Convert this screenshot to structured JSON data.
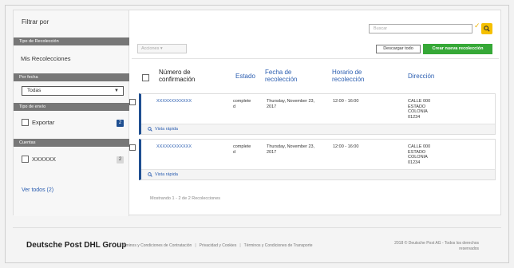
{
  "sidebar": {
    "title": "Filtrar por",
    "sections": [
      {
        "header": "Tipo de Recolección",
        "item": "Mis Recolecciones"
      },
      {
        "header": "Por fecha",
        "select_value": "Todas"
      },
      {
        "header": "Tipo de envío",
        "checkbox_label": "Exportar",
        "count": "2"
      },
      {
        "header": "Cuentas",
        "checkbox_label": "XXXXXX",
        "count": "2"
      }
    ],
    "view_all": "Ver todos (2)"
  },
  "toolbar": {
    "search_placeholder": "Buscar",
    "actions_label": "Acciones ▾",
    "download_label": "Descargar todo",
    "new_label": "Crear nueva recolección"
  },
  "table": {
    "headers": [
      "Número de confirmación",
      "Estado",
      "Fecha de recolección",
      "Horario de recolección",
      "Dirección"
    ],
    "rows": [
      {
        "number": "XXXXXXXXXXXX",
        "status": "complete d",
        "date": "Thursday, November 23, 2017",
        "time": "12:00 - 16:00",
        "address": "CALLE 000 ESTADO COLONIA 01234",
        "quick_view": "Vista rápida"
      },
      {
        "number": "XXXXXXXXXXXX",
        "status": "complete d",
        "date": "Thursday, November 23, 2017",
        "time": "12:00 - 16:00",
        "address": "CALLE 000 ESTADO COLONIA 01234",
        "quick_view": "Vista rápida"
      }
    ],
    "showing": "Mostrando 1 - 2 de 2 Recolecciones"
  },
  "footer": {
    "brand": "Deutsche Post DHL Group",
    "links": [
      "Términos y Condiciones de Contratación",
      "Privacidad y Cookies",
      "Términos y Condiciones de Transporte"
    ],
    "copyright": "2018 © Deutsche Post AG - Todos los derechos reservados"
  },
  "colors": {
    "accent_blue": "#2a5db0",
    "green": "#36a837",
    "yellow": "#f5c000",
    "dark_blue": "#1f4f91"
  }
}
